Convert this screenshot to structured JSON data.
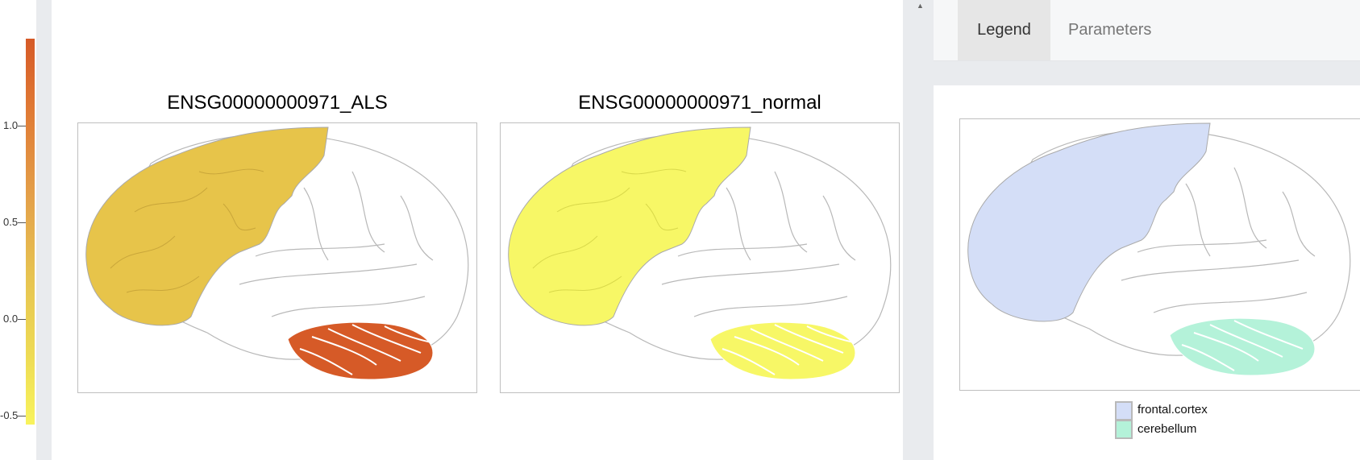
{
  "colorbar": {
    "ticks": [
      {
        "label": "1.0",
        "value": 1.0
      },
      {
        "label": "0.5",
        "value": 0.5
      },
      {
        "label": "0.0",
        "value": 0.0
      },
      {
        "label": "-0.5",
        "value": -0.5
      }
    ],
    "colors": {
      "high": "#d65a27",
      "low": "#f8f35c"
    }
  },
  "panels": [
    {
      "title": "ENSG00000000971_ALS",
      "frontal_color": "#e7c44a",
      "cerebellum_color": "#d65a27"
    },
    {
      "title": "ENSG00000000971_normal",
      "frontal_color": "#f7f766",
      "cerebellum_color": "#f7f766"
    }
  ],
  "tabs": {
    "legend": "Legend",
    "parameters": "Parameters"
  },
  "legend": {
    "items": [
      {
        "label": "frontal.cortex",
        "color": "#d4def7"
      },
      {
        "label": "cerebellum",
        "color": "#b4f2d9"
      }
    ]
  }
}
